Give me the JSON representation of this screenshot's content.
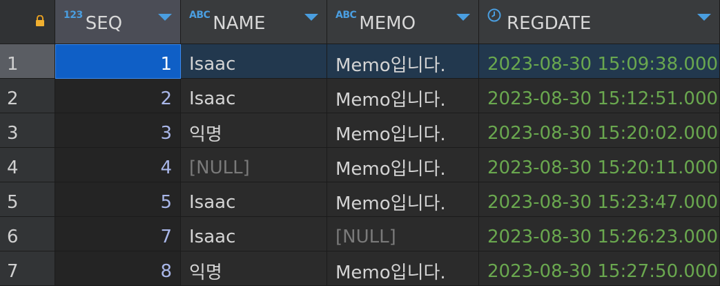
{
  "header": {
    "corner_icon": "lock-icon",
    "columns": [
      {
        "type_tag": "123",
        "label": "SEQ"
      },
      {
        "type_tag": "ABC",
        "label": "NAME"
      },
      {
        "type_tag": "ABC",
        "label": "MEMO"
      },
      {
        "type_icon": "clock-icon",
        "label": "REGDATE"
      }
    ]
  },
  "rows": [
    {
      "num": "1",
      "seq": "1",
      "name": "Isaac",
      "memo": "Memo입니다.",
      "regdate": "2023-08-30 15:09:38.000"
    },
    {
      "num": "2",
      "seq": "2",
      "name": "Isaac",
      "memo": "Memo입니다.",
      "regdate": "2023-08-30 15:12:51.000"
    },
    {
      "num": "3",
      "seq": "3",
      "name": "익명",
      "memo": "Memo입니다.",
      "regdate": "2023-08-30 15:20:02.000"
    },
    {
      "num": "4",
      "seq": "4",
      "name": "[NULL]",
      "memo": "Memo입니다.",
      "regdate": "2023-08-30 15:20:11.000"
    },
    {
      "num": "5",
      "seq": "5",
      "name": "Isaac",
      "memo": "Memo입니다.",
      "regdate": "2023-08-30 15:23:47.000"
    },
    {
      "num": "6",
      "seq": "7",
      "name": "Isaac",
      "memo": "[NULL]",
      "regdate": "2023-08-30 15:26:23.000"
    },
    {
      "num": "7",
      "seq": "8",
      "name": "익명",
      "memo": "Memo입니다.",
      "regdate": "2023-08-30 15:27:50.000"
    }
  ],
  "colors": {
    "type_tag": "#4a9ee0",
    "date_text": "#6aa84f",
    "seq_text": "#a9b7e9",
    "null_text": "#7a7a7a",
    "selected_cell": "#0f5fc6"
  }
}
